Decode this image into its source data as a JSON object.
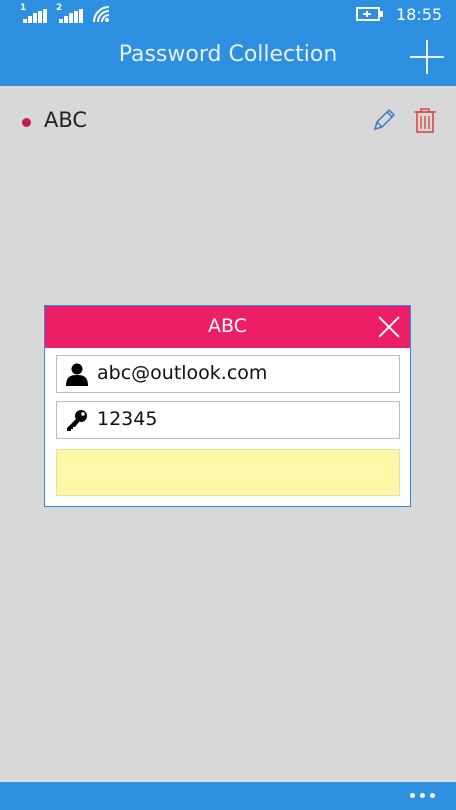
{
  "status_bar": {
    "sim1": "1",
    "sim2": "2",
    "time": "18:55"
  },
  "header": {
    "title": "Password Collection",
    "add_icon": "plus-icon"
  },
  "list": {
    "items": [
      {
        "label": "ABC",
        "bullet_color": "#c2185b"
      }
    ]
  },
  "dialog": {
    "title": "ABC",
    "header_color": "#ec1f66",
    "username": "abc@outlook.com",
    "password": "12345",
    "notes": ""
  },
  "colors": {
    "accent": "#2d8fe0",
    "background": "#d8d8d8",
    "notes_bg": "#fff6a8"
  }
}
